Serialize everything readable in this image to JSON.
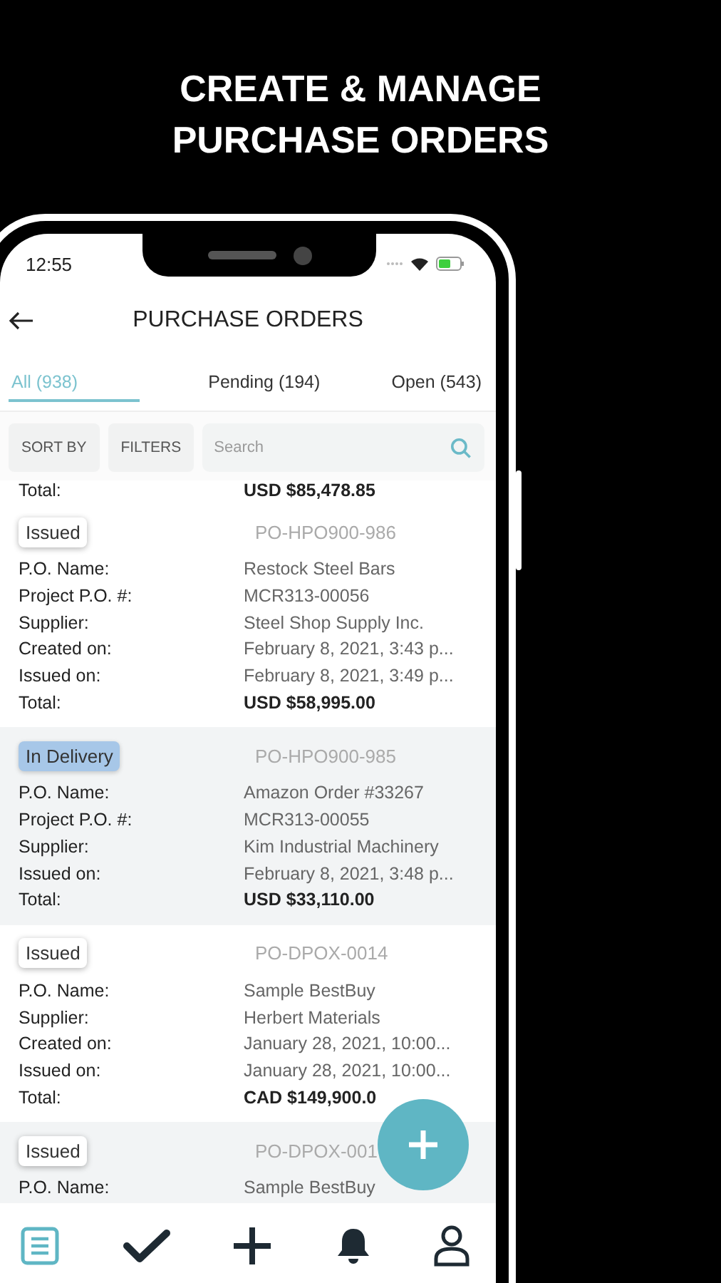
{
  "headline": [
    "CREATE & MANAGE",
    "PURCHASE ORDERS"
  ],
  "status_bar": {
    "time": "12:55"
  },
  "header": {
    "title": "PURCHASE ORDERS"
  },
  "tabs": [
    {
      "label": "All (938)",
      "selected": true
    },
    {
      "label": "Pending (194)",
      "selected": false
    },
    {
      "label": "Open (543)",
      "selected": false
    }
  ],
  "toolbar": {
    "sort": "SORT BY",
    "filters": "FILTERS",
    "search": {
      "placeholder": "Search"
    }
  },
  "previous_total": {
    "label": "Total:",
    "value": "USD $85,478.85"
  },
  "orders": [
    {
      "status": "Issued",
      "kind": "issued",
      "number": "PO-HPO900-986",
      "fields": [
        {
          "label": "P.O. Name:",
          "value": "Restock Steel Bars"
        },
        {
          "label": "Project P.O. #:",
          "value": "MCR313-00056"
        },
        {
          "label": "Supplier:",
          "value": "Steel Shop Supply Inc."
        },
        {
          "label": "Created on:",
          "value": "February 8, 2021, 3:43 p..."
        },
        {
          "label": "Issued on:",
          "value": "February 8, 2021, 3:49 p..."
        }
      ],
      "total": {
        "label": "Total:",
        "value": "USD $58,995.00"
      }
    },
    {
      "status": "In Delivery",
      "kind": "delivery",
      "number": "PO-HPO900-985",
      "fields": [
        {
          "label": "P.O. Name:",
          "value": "Amazon Order #33267"
        },
        {
          "label": "Project P.O. #:",
          "value": "MCR313-00055"
        },
        {
          "label": "Supplier:",
          "value": "Kim Industrial Machinery"
        },
        {
          "label": "Issued on:",
          "value": "February 8, 2021, 3:48 p..."
        }
      ],
      "total": {
        "label": "Total:",
        "value": "USD $33,110.00"
      }
    },
    {
      "status": "Issued",
      "kind": "issued",
      "number": "PO-DPOX-0014",
      "fields": [
        {
          "label": "P.O. Name:",
          "value": "Sample  BestBuy"
        },
        {
          "label": "Supplier:",
          "value": "Herbert Materials"
        },
        {
          "label": "Created on:",
          "value": "January 28, 2021, 10:00..."
        },
        {
          "label": "Issued on:",
          "value": "January 28, 2021, 10:00..."
        }
      ],
      "total": {
        "label": "Total:",
        "value": "CAD $149,900.0"
      }
    },
    {
      "status": "Issued",
      "kind": "issued",
      "number": "PO-DPOX-001",
      "fields": [
        {
          "label": "P.O. Name:",
          "value": "Sample  BestBuy"
        }
      ]
    }
  ],
  "bottom_nav": [
    {
      "kind": "list",
      "selected": true
    },
    {
      "kind": "check",
      "selected": false
    },
    {
      "kind": "plus",
      "selected": false
    },
    {
      "kind": "bell",
      "selected": false
    },
    {
      "kind": "user",
      "selected": false
    }
  ]
}
